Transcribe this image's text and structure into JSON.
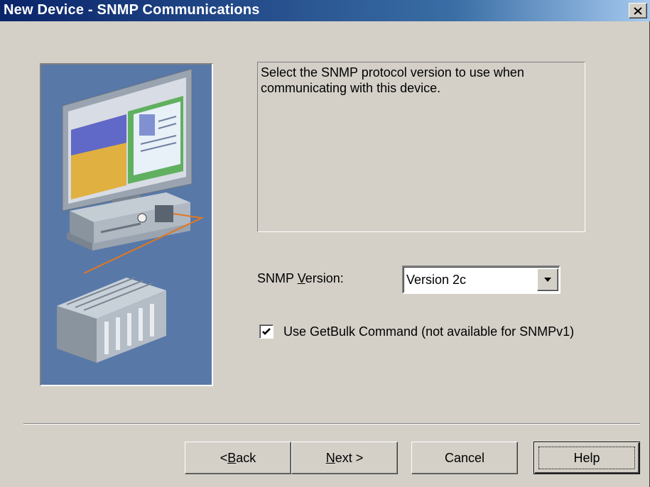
{
  "window": {
    "title": "New Device - SNMP Communications",
    "close_icon": "close-icon"
  },
  "description": "Select the SNMP protocol version to use when communicating with this device.",
  "version": {
    "label_before": "SNMP ",
    "label_accel": "V",
    "label_after": "ersion:",
    "selected": "Version 2c"
  },
  "getbulk": {
    "label": "Use GetBulk Command (not available for SNMPv1)",
    "checked": true
  },
  "buttons": {
    "back_prefix": "< ",
    "back_accel": "B",
    "back_rest": "ack",
    "next_accel": "N",
    "next_rest": "ext >",
    "cancel": "Cancel",
    "help": "Help"
  },
  "illustration": "computer-and-plc-illustration",
  "colors": {
    "titlebar_start": "#0a246a",
    "titlebar_end": "#a6caf0",
    "dialog_bg": "#d4d0c8",
    "illustration_bg": "#5878a8"
  }
}
